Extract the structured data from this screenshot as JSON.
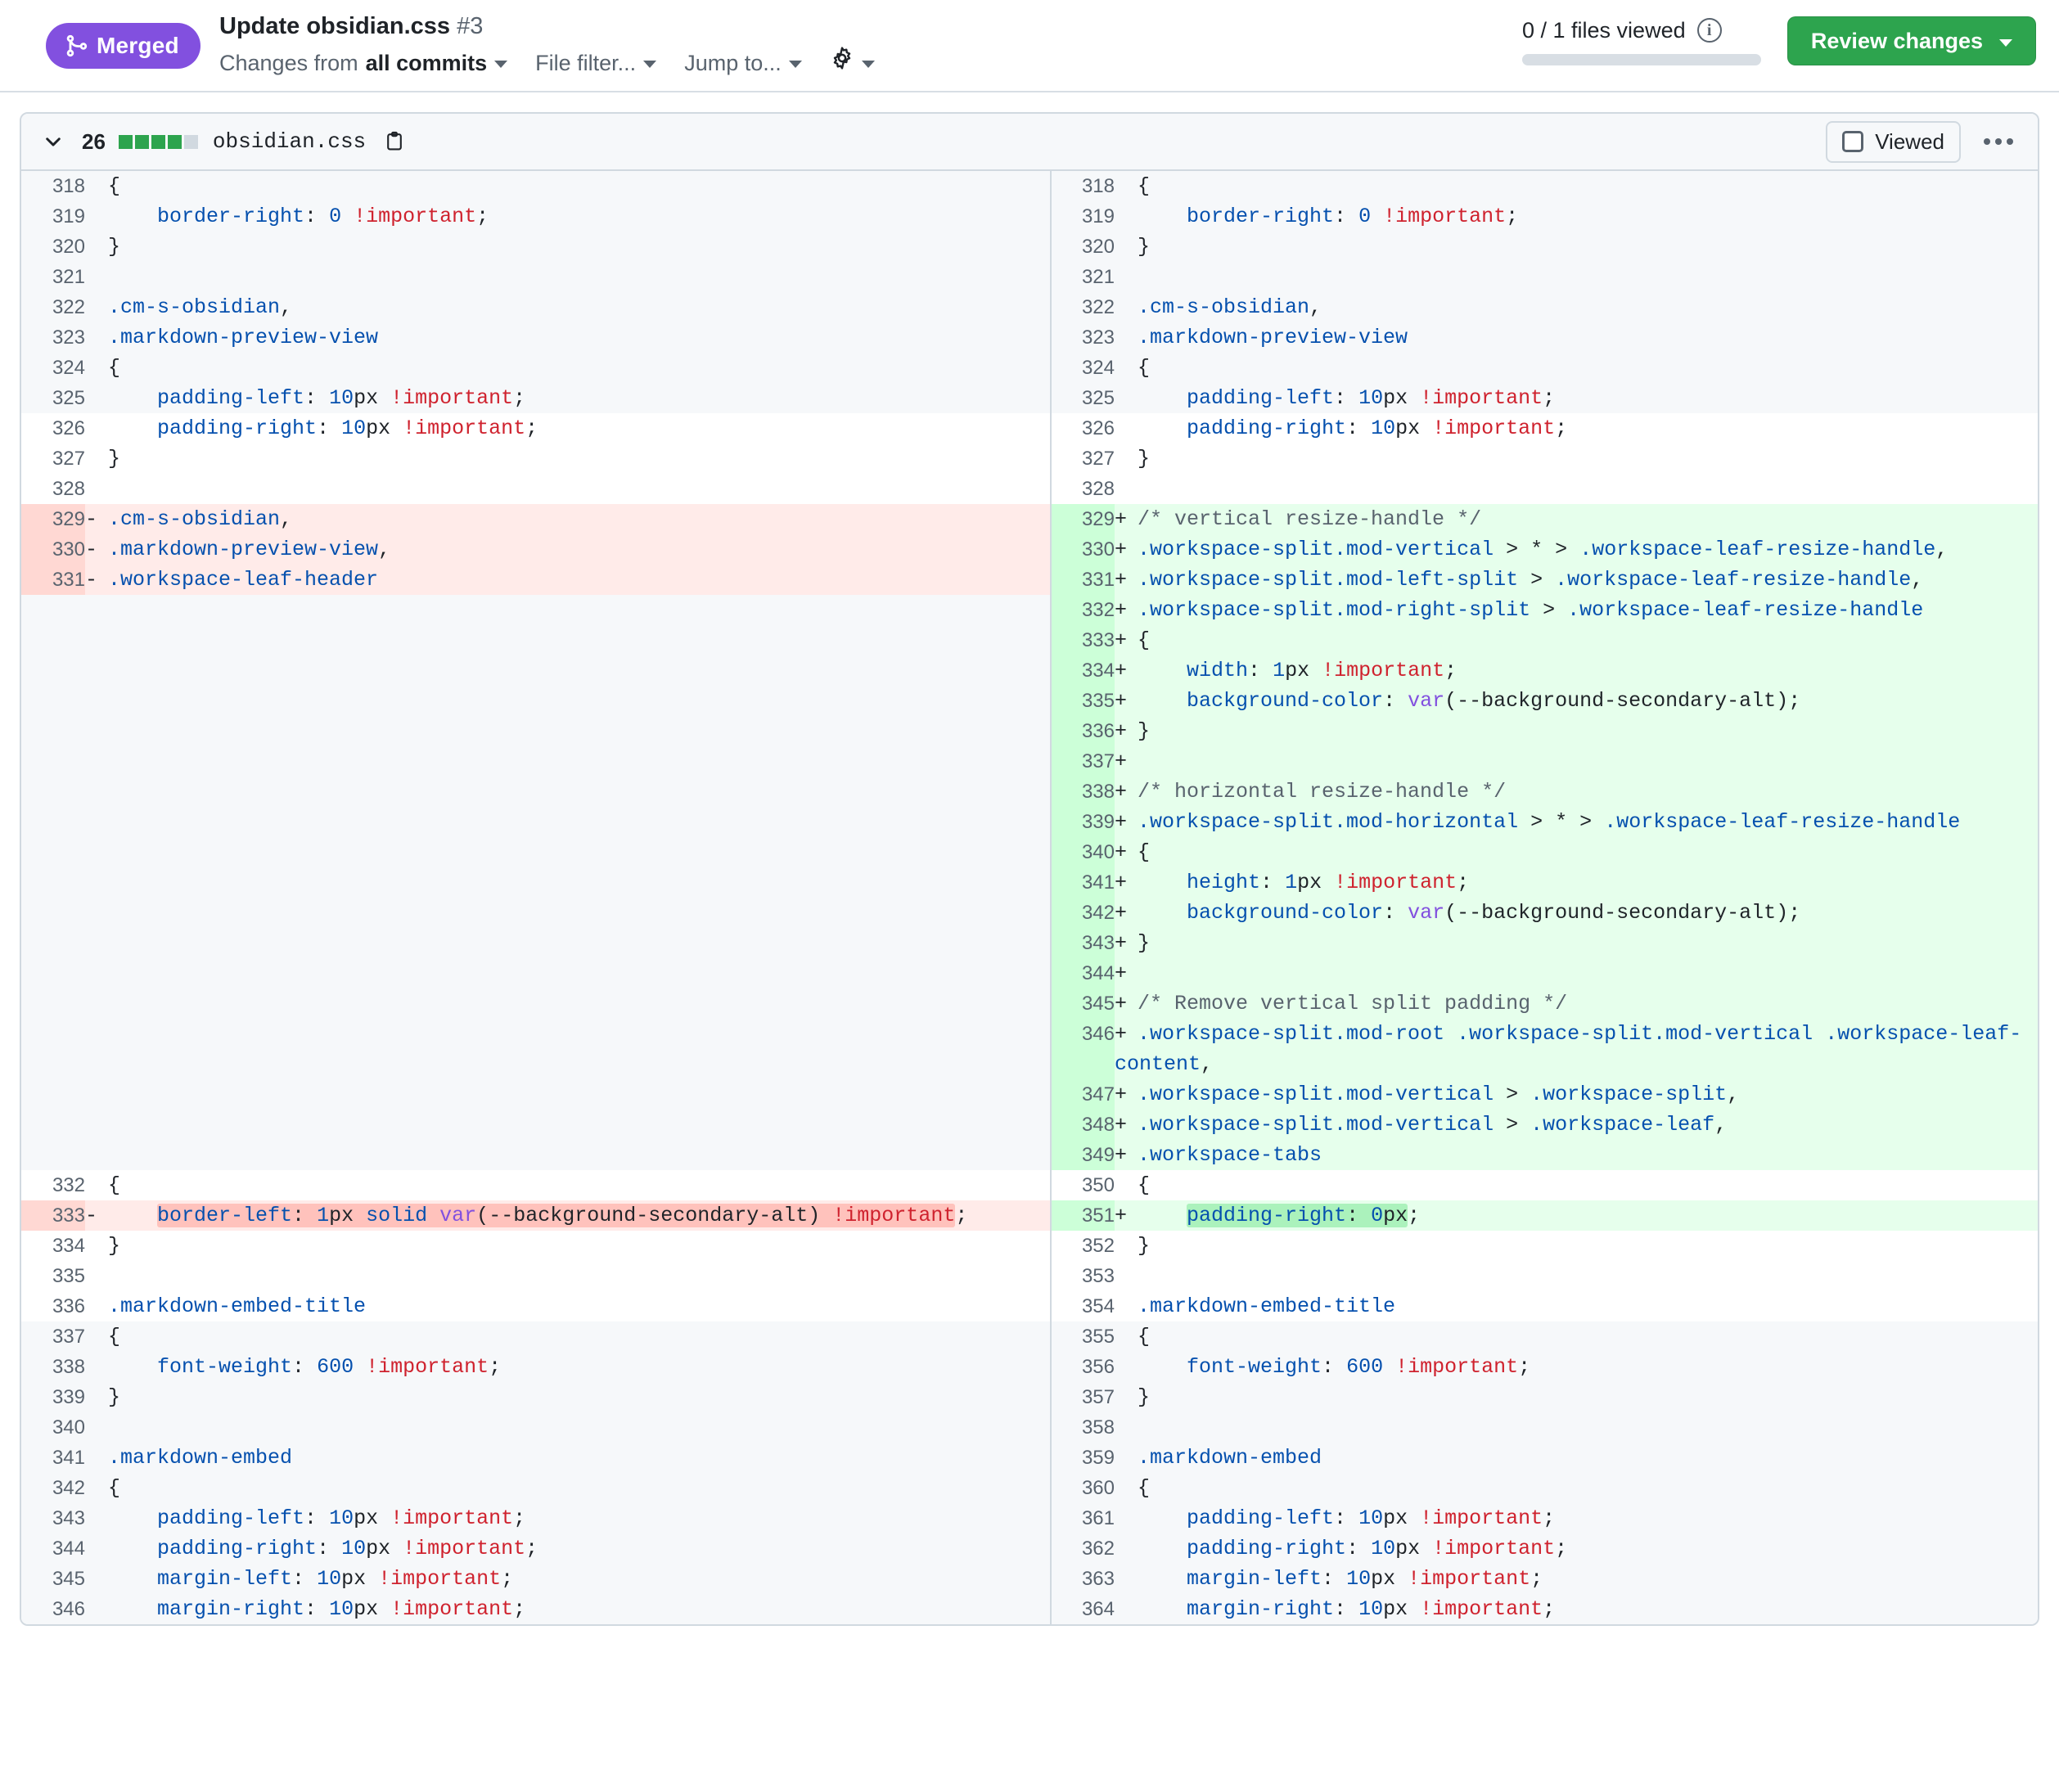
{
  "header": {
    "status_badge": "Merged",
    "pr_title": "Update obsidian.css",
    "pr_number": "#3",
    "changes_from_prefix": "Changes from",
    "changes_from_value": "all commits",
    "file_filter_label": "File filter...",
    "jump_to_label": "Jump to...",
    "gear_icon": "gear-icon",
    "files_viewed": "0 / 1 files viewed",
    "info_icon_char": "i",
    "review_changes_label": "Review changes",
    "accent_merged": "#8250df",
    "accent_green": "#2da44e"
  },
  "file": {
    "diff_count": "26",
    "diffstat_blocks": [
      "#2da44e",
      "#2da44e",
      "#2da44e",
      "#2da44e",
      "#d1d9e0"
    ],
    "name": "obsidian.css",
    "copy_icon": "copy-path-icon",
    "viewed_label": "Viewed",
    "viewed_checked": false,
    "kebab_icon": "kebab-menu-icon"
  },
  "diff": {
    "rows": [
      {
        "t": "hunktop",
        "ln": "318",
        "rn": "318",
        "lh": "<span class=\"punc\">{</span>",
        "rh": "<span class=\"punc\">{</span>"
      },
      {
        "t": "hunktop",
        "ln": "319",
        "rn": "319",
        "lh": "    <span class=\"prop\">border-right</span><span class=\"punc\">:</span> <span class=\"num2\">0</span> <span class=\"imp\">!important</span><span class=\"punc\">;</span>",
        "rh": "    <span class=\"prop\">border-right</span><span class=\"punc\">:</span> <span class=\"num2\">0</span> <span class=\"imp\">!important</span><span class=\"punc\">;</span>"
      },
      {
        "t": "hunktop",
        "ln": "320",
        "rn": "320",
        "lh": "<span class=\"punc\">}</span>",
        "rh": "<span class=\"punc\">}</span>"
      },
      {
        "t": "hunktop",
        "ln": "321",
        "rn": "321",
        "lh": "",
        "rh": ""
      },
      {
        "t": "hunktop",
        "ln": "322",
        "rn": "322",
        "lh": "<span class=\"sel\">.cm-s-obsidian</span><span class=\"punc\">,</span>",
        "rh": "<span class=\"sel\">.cm-s-obsidian</span><span class=\"punc\">,</span>"
      },
      {
        "t": "hunktop",
        "ln": "323",
        "rn": "323",
        "lh": "<span class=\"sel\">.markdown-preview-view</span>",
        "rh": "<span class=\"sel\">.markdown-preview-view</span>"
      },
      {
        "t": "hunktop",
        "ln": "324",
        "rn": "324",
        "lh": "<span class=\"punc\">{</span>",
        "rh": "<span class=\"punc\">{</span>"
      },
      {
        "t": "hunktop",
        "ln": "325",
        "rn": "325",
        "lh": "    <span class=\"prop\">padding-left</span><span class=\"punc\">:</span> <span class=\"num2\">10</span><span class=\"unit\">px</span> <span class=\"imp\">!important</span><span class=\"punc\">;</span>",
        "rh": "    <span class=\"prop\">padding-left</span><span class=\"punc\">:</span> <span class=\"num2\">10</span><span class=\"unit\">px</span> <span class=\"imp\">!important</span><span class=\"punc\">;</span>"
      },
      {
        "t": "ctx",
        "ln": "326",
        "rn": "326",
        "lh": "    <span class=\"prop\">padding-right</span><span class=\"punc\">:</span> <span class=\"num2\">10</span><span class=\"unit\">px</span> <span class=\"imp\">!important</span><span class=\"punc\">;</span>",
        "rh": "    <span class=\"prop\">padding-right</span><span class=\"punc\">:</span> <span class=\"num2\">10</span><span class=\"unit\">px</span> <span class=\"imp\">!important</span><span class=\"punc\">;</span>"
      },
      {
        "t": "ctx",
        "ln": "327",
        "rn": "327",
        "lh": "<span class=\"punc\">}</span>",
        "rh": "<span class=\"punc\">}</span>"
      },
      {
        "t": "ctx",
        "ln": "328",
        "rn": "328",
        "lh": "",
        "rh": ""
      },
      {
        "t": "del-add",
        "ln": "329",
        "rn": "329",
        "ls": "-",
        "rs": "+",
        "lh": "<span class=\"sel\">.cm-s-obsidian</span><span class=\"punc\">,</span>",
        "rh": "<span class=\"cmt\">/* vertical resize-handle */</span>"
      },
      {
        "t": "del-add",
        "ln": "330",
        "rn": "330",
        "ls": "-",
        "rs": "+",
        "lh": "<span class=\"sel\">.markdown-preview-view</span><span class=\"punc\">,</span>",
        "rh": "<span class=\"sel\">.workspace-split</span><span class=\"sel\">.mod-vertical</span> <span class=\"punc\">&gt;</span> <span class=\"punc\">*</span> <span class=\"punc\">&gt;</span> <span class=\"sel\">.workspace-leaf-resize-handle</span><span class=\"punc\">,</span>"
      },
      {
        "t": "del-add",
        "ln": "331",
        "rn": "331",
        "ls": "-",
        "rs": "+",
        "lh": "<span class=\"sel\">.workspace-leaf-header</span>",
        "rh": "<span class=\"sel\">.workspace-split</span><span class=\"sel\">.mod-left-split</span> <span class=\"punc\">&gt;</span> <span class=\"sel\">.workspace-leaf-resize-handle</span><span class=\"punc\">,</span>"
      },
      {
        "t": "add",
        "ln": "",
        "rn": "332",
        "rs": "+",
        "lh": "",
        "rh": "<span class=\"sel\">.workspace-split</span><span class=\"sel\">.mod-right-split</span> <span class=\"punc\">&gt;</span> <span class=\"sel\">.workspace-leaf-resize-handle</span>"
      },
      {
        "t": "add",
        "ln": "",
        "rn": "333",
        "rs": "+",
        "lh": "",
        "rh": "<span class=\"punc\">{</span>"
      },
      {
        "t": "add",
        "ln": "",
        "rn": "334",
        "rs": "+",
        "lh": "",
        "rh": "    <span class=\"prop\">width</span><span class=\"punc\">:</span> <span class=\"num2\">1</span><span class=\"unit\">px</span> <span class=\"imp\">!important</span><span class=\"punc\">;</span>"
      },
      {
        "t": "add",
        "ln": "",
        "rn": "335",
        "rs": "+",
        "lh": "",
        "rh": "    <span class=\"prop\">background-color</span><span class=\"punc\">:</span> <span class=\"fn\">var</span><span class=\"punc\">(</span><span class=\"var\">--background-secondary-alt</span><span class=\"punc\">);</span>"
      },
      {
        "t": "add",
        "ln": "",
        "rn": "336",
        "rs": "+",
        "lh": "",
        "rh": "<span class=\"punc\">}</span>"
      },
      {
        "t": "add",
        "ln": "",
        "rn": "337",
        "rs": "+",
        "lh": "",
        "rh": ""
      },
      {
        "t": "add",
        "ln": "",
        "rn": "338",
        "rs": "+",
        "lh": "",
        "rh": "<span class=\"cmt\">/* horizontal resize-handle */</span>"
      },
      {
        "t": "add",
        "ln": "",
        "rn": "339",
        "rs": "+",
        "lh": "",
        "rh": "<span class=\"sel\">.workspace-split</span><span class=\"sel\">.mod-horizontal</span> <span class=\"punc\">&gt;</span> <span class=\"punc\">*</span> <span class=\"punc\">&gt;</span> <span class=\"sel\">.workspace-leaf-resize-handle</span>"
      },
      {
        "t": "add",
        "ln": "",
        "rn": "340",
        "rs": "+",
        "lh": "",
        "rh": "<span class=\"punc\">{</span>"
      },
      {
        "t": "add",
        "ln": "",
        "rn": "341",
        "rs": "+",
        "lh": "",
        "rh": "    <span class=\"prop\">height</span><span class=\"punc\">:</span> <span class=\"num2\">1</span><span class=\"unit\">px</span> <span class=\"imp\">!important</span><span class=\"punc\">;</span>"
      },
      {
        "t": "add",
        "ln": "",
        "rn": "342",
        "rs": "+",
        "lh": "",
        "rh": "    <span class=\"prop\">background-color</span><span class=\"punc\">:</span> <span class=\"fn\">var</span><span class=\"punc\">(</span><span class=\"var\">--background-secondary-alt</span><span class=\"punc\">);</span>"
      },
      {
        "t": "add",
        "ln": "",
        "rn": "343",
        "rs": "+",
        "lh": "",
        "rh": "<span class=\"punc\">}</span>"
      },
      {
        "t": "add",
        "ln": "",
        "rn": "344",
        "rs": "+",
        "lh": "",
        "rh": ""
      },
      {
        "t": "add",
        "ln": "",
        "rn": "345",
        "rs": "+",
        "lh": "",
        "rh": "<span class=\"cmt\">/* Remove vertical split padding */</span>"
      },
      {
        "t": "add",
        "ln": "",
        "rn": "346",
        "rs": "+",
        "lh": "",
        "rh": "<span class=\"sel\">.workspace-split</span><span class=\"sel\">.mod-root</span> <span class=\"sel\">.workspace-split</span><span class=\"sel\">.mod-vertical</span> <span class=\"sel\">.workspace-leaf-content</span><span class=\"punc\">,</span>"
      },
      {
        "t": "add",
        "ln": "",
        "rn": "347",
        "rs": "+",
        "lh": "",
        "rh": "<span class=\"sel\">.workspace-split</span><span class=\"sel\">.mod-vertical</span> <span class=\"punc\">&gt;</span> <span class=\"sel\">.workspace-split</span><span class=\"punc\">,</span>"
      },
      {
        "t": "add",
        "ln": "",
        "rn": "348",
        "rs": "+",
        "lh": "",
        "rh": "<span class=\"sel\">.workspace-split</span><span class=\"sel\">.mod-vertical</span> <span class=\"punc\">&gt;</span> <span class=\"sel\">.workspace-leaf</span><span class=\"punc\">,</span>"
      },
      {
        "t": "add",
        "ln": "",
        "rn": "349",
        "rs": "+",
        "lh": "",
        "rh": "<span class=\"sel\">.workspace-tabs</span>"
      },
      {
        "t": "ctx",
        "ln": "332",
        "rn": "350",
        "lh": "<span class=\"punc\">{</span>",
        "rh": "<span class=\"punc\">{</span>"
      },
      {
        "t": "del-add",
        "ln": "333",
        "rn": "351",
        "ls": "-",
        "rs": "+",
        "lh": "    <span class=\"del-hl\"><span class=\"prop\">border-left</span><span class=\"punc\">:</span> <span class=\"num2\">1</span><span class=\"unit\">px</span> <span class=\"val\">solid</span> <span class=\"fn\">var</span><span class=\"punc\">(</span><span class=\"var\">--background-secondary-alt</span><span class=\"punc\">)</span> <span class=\"imp\">!important</span></span><span class=\"punc\">;</span>",
        "rh": "    <span class=\"add-hl\"><span class=\"prop\">padding-right</span><span class=\"punc\">:</span> <span class=\"num2\">0</span><span class=\"unit\">px</span></span><span class=\"punc\">;</span>"
      },
      {
        "t": "ctx",
        "ln": "334",
        "rn": "352",
        "lh": "<span class=\"punc\">}</span>",
        "rh": "<span class=\"punc\">}</span>"
      },
      {
        "t": "ctx",
        "ln": "335",
        "rn": "353",
        "lh": "",
        "rh": ""
      },
      {
        "t": "ctx",
        "ln": "336",
        "rn": "354",
        "lh": "<span class=\"sel\">.markdown-embed-title</span>",
        "rh": "<span class=\"sel\">.markdown-embed-title</span>"
      },
      {
        "t": "hunktop",
        "ln": "337",
        "rn": "355",
        "lh": "<span class=\"punc\">{</span>",
        "rh": "<span class=\"punc\">{</span>"
      },
      {
        "t": "hunktop",
        "ln": "338",
        "rn": "356",
        "lh": "    <span class=\"prop\">font-weight</span><span class=\"punc\">:</span> <span class=\"num2\">600</span> <span class=\"imp\">!important</span><span class=\"punc\">;</span>",
        "rh": "    <span class=\"prop\">font-weight</span><span class=\"punc\">:</span> <span class=\"num2\">600</span> <span class=\"imp\">!important</span><span class=\"punc\">;</span>"
      },
      {
        "t": "hunktop",
        "ln": "339",
        "rn": "357",
        "lh": "<span class=\"punc\">}</span>",
        "rh": "<span class=\"punc\">}</span>"
      },
      {
        "t": "hunktop",
        "ln": "340",
        "rn": "358",
        "lh": "",
        "rh": ""
      },
      {
        "t": "hunktop",
        "ln": "341",
        "rn": "359",
        "lh": "<span class=\"sel\">.markdown-embed</span>",
        "rh": "<span class=\"sel\">.markdown-embed</span>"
      },
      {
        "t": "hunktop",
        "ln": "342",
        "rn": "360",
        "lh": "<span class=\"punc\">{</span>",
        "rh": "<span class=\"punc\">{</span>"
      },
      {
        "t": "hunktop",
        "ln": "343",
        "rn": "361",
        "lh": "    <span class=\"prop\">padding-left</span><span class=\"punc\">:</span> <span class=\"num2\">10</span><span class=\"unit\">px</span> <span class=\"imp\">!important</span><span class=\"punc\">;</span>",
        "rh": "    <span class=\"prop\">padding-left</span><span class=\"punc\">:</span> <span class=\"num2\">10</span><span class=\"unit\">px</span> <span class=\"imp\">!important</span><span class=\"punc\">;</span>"
      },
      {
        "t": "hunktop",
        "ln": "344",
        "rn": "362",
        "lh": "    <span class=\"prop\">padding-right</span><span class=\"punc\">:</span> <span class=\"num2\">10</span><span class=\"unit\">px</span> <span class=\"imp\">!important</span><span class=\"punc\">;</span>",
        "rh": "    <span class=\"prop\">padding-right</span><span class=\"punc\">:</span> <span class=\"num2\">10</span><span class=\"unit\">px</span> <span class=\"imp\">!important</span><span class=\"punc\">;</span>"
      },
      {
        "t": "hunktop",
        "ln": "345",
        "rn": "363",
        "lh": "    <span class=\"prop\">margin-left</span><span class=\"punc\">:</span> <span class=\"num2\">10</span><span class=\"unit\">px</span> <span class=\"imp\">!important</span><span class=\"punc\">;</span>",
        "rh": "    <span class=\"prop\">margin-left</span><span class=\"punc\">:</span> <span class=\"num2\">10</span><span class=\"unit\">px</span> <span class=\"imp\">!important</span><span class=\"punc\">;</span>"
      },
      {
        "t": "hunktop",
        "ln": "346",
        "rn": "364",
        "lh": "    <span class=\"prop\">margin-right</span><span class=\"punc\">:</span> <span class=\"num2\">10</span><span class=\"unit\">px</span> <span class=\"imp\">!important</span><span class=\"punc\">;</span>",
        "rh": "    <span class=\"prop\">margin-right</span><span class=\"punc\">:</span> <span class=\"num2\">10</span><span class=\"unit\">px</span> <span class=\"imp\">!important</span><span class=\"punc\">;</span>"
      }
    ]
  }
}
